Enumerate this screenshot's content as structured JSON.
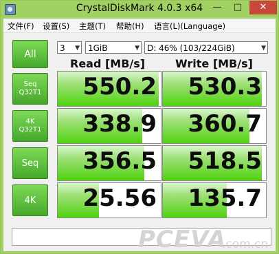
{
  "window": {
    "title": "CrystalDiskMark 4.0.3 x64",
    "min_label": "—",
    "max_label": "□",
    "close_label": "✕"
  },
  "menu": [
    "文件(F)",
    "设置(S)",
    "主题(T)",
    "帮助(H)",
    "语言(L)(Language)"
  ],
  "controls": {
    "all_button": "All",
    "count_value": "3",
    "size_value": "1GiB",
    "drive_value": "D: 46% (103/224GiB)"
  },
  "headers": {
    "read": "Read [MB/s]",
    "write": "Write [MB/s]"
  },
  "tests": [
    {
      "line1": "Seq",
      "line2": "Q32T1",
      "read": "550.2",
      "write": "530.3",
      "read_fill": 0.98,
      "write_fill": 0.96
    },
    {
      "line1": "4K",
      "line2": "Q32T1",
      "read": "338.9",
      "write": "360.7",
      "read_fill": 0.82,
      "write_fill": 0.84
    },
    {
      "line1": "Seq",
      "line2": "",
      "read": "356.5",
      "write": "518.5",
      "read_fill": 0.84,
      "write_fill": 0.96
    },
    {
      "line1": "4K",
      "line2": "",
      "read": "25.56",
      "write": "135.7",
      "read_fill": 0.4,
      "write_fill": 0.62
    }
  ],
  "comment": "",
  "watermark": {
    "text": "PCEVA",
    "sub": ".com.cn"
  },
  "colors": {
    "accent": "#4fd30f",
    "frame": "#a2d163",
    "button": "#45a82b",
    "close": "#c7473a"
  }
}
